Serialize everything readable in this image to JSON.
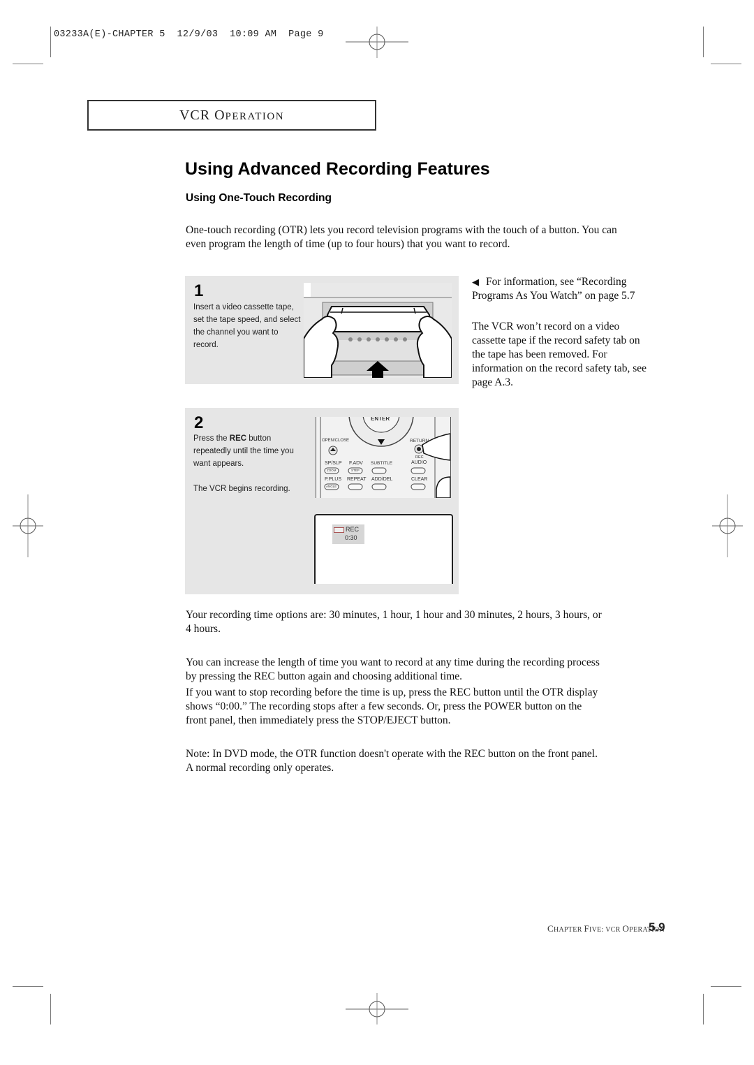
{
  "slug": {
    "job": "03233A(E)-CHAPTER 5",
    "date": "12/9/03",
    "time": "10:09 AM",
    "page": "Page 9"
  },
  "section_header": {
    "first": "VCR ",
    "cap": "O",
    "rest": "PERATION"
  },
  "page_title": "Using Advanced Recording Features",
  "subtitle": "Using One-Touch Recording",
  "intro": "One-touch recording (OTR) lets you record television programs with the touch of a button. You can even program the length of time (up to four hours) that you want to record.",
  "steps": [
    {
      "number": "1",
      "text": "Insert a video cassette tape, set the tape speed, and select the channel you want to record.",
      "illustration": "hands-inserting-cassette"
    },
    {
      "number": "2",
      "text_before": "Press the ",
      "text_bold": "REC",
      "text_after": " button repeatedly until the time you want appears.",
      "text2": "The VCR begins recording.",
      "illustration": "remote-control-rec-button",
      "remote_labels": {
        "enter": "ENTER",
        "open_close": "OPEN/CLOSE",
        "return": "RETURN",
        "rec": "REC",
        "row1": [
          "SP/SLP",
          "F.ADV",
          "SUBTITLE",
          "AUDIO"
        ],
        "row1_sub": [
          "ZOOM",
          "STEP",
          "",
          ""
        ],
        "row2": [
          "P.PLUS",
          "REPEAT",
          "ADD/DEL",
          "CLEAR"
        ],
        "row2_sub": [
          "ANGLE",
          "",
          "",
          ""
        ]
      },
      "screen": {
        "osd_label": "REC",
        "osd_time": "0:30",
        "icon": "cassette-icon"
      }
    }
  ],
  "sidebar": {
    "note1": "For information, see “Recording Programs As You Watch” on page 5.7",
    "note1_icon": "left-pointer-icon",
    "note2": "The VCR won’t record on a video cassette tape if the record safety tab on the tape has been removed. For information on the record safety tab, see page A.3."
  },
  "body": [
    "Your recording time options are: 30 minutes, 1 hour, 1 hour and 30 minutes, 2 hours, 3 hours, or 4 hours.",
    "You can increase the length of time you want to record at any time during the recording process by pressing the REC button again and choosing additional time.",
    "If you want to stop recording before the time is up, press the REC button until the OTR display shows “0:00.” The recording stops after a few seconds. Or, press the POWER button on the front panel, then immediately press the STOP/EJECT button.",
    "Note: In DVD mode, the OTR function doesn't operate with the REC button on the front panel. A normal recording only operates."
  ],
  "footer": {
    "chapter_c": "C",
    "chapter_rest": "HAPTER ",
    "five_f": "F",
    "five_rest": "IVE: VCR ",
    "op_o": "O",
    "op_rest": "PERATION",
    "page_number": "5.9"
  }
}
